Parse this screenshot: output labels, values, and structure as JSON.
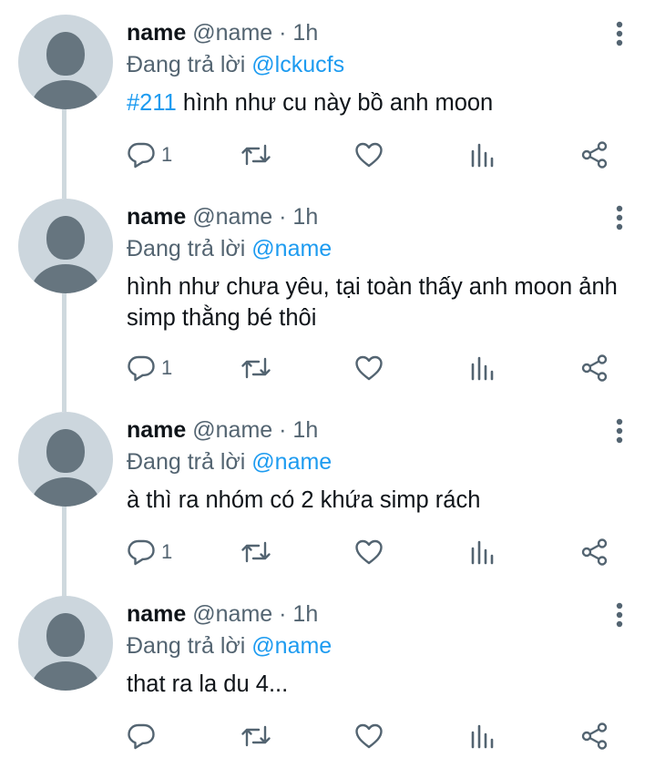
{
  "colors": {
    "accent": "#1d9bf0",
    "secondary_text": "#536471",
    "primary_text": "#0f1419",
    "thread_line": "#cfd9de",
    "avatar_bg": "#ccd6dd"
  },
  "icons": {
    "more": "vertical-ellipsis-icon",
    "reply": "speech-bubble-icon",
    "retweet": "retweet-arrows-icon",
    "like": "heart-icon",
    "views": "bar-chart-icon",
    "share": "share-icon"
  },
  "tweets": [
    {
      "name": "name",
      "handle": "@name",
      "separator": "·",
      "time": "1h",
      "reply_prefix": "Đang trả lời",
      "reply_to": "@lckucfs",
      "hashtag": "#211",
      "text": " hình như cu này bồ anh moon",
      "reply_count": "1"
    },
    {
      "name": "name",
      "handle": "@name",
      "separator": "·",
      "time": "1h",
      "reply_prefix": "Đang trả lời",
      "reply_to": "@name",
      "hashtag": "",
      "text": "hình như chưa yêu, tại toàn thấy anh moon ảnh simp thằng bé thôi",
      "reply_count": "1"
    },
    {
      "name": "name",
      "handle": "@name",
      "separator": "·",
      "time": "1h",
      "reply_prefix": "Đang trả lời",
      "reply_to": "@name",
      "hashtag": "",
      "text": "à thì ra nhóm có 2 khứa simp rách",
      "reply_count": "1"
    },
    {
      "name": "name",
      "handle": "@name",
      "separator": "·",
      "time": "1h",
      "reply_prefix": "Đang trả lời",
      "reply_to": "@name",
      "hashtag": "",
      "text": "that ra la du 4...",
      "reply_count": ""
    }
  ]
}
